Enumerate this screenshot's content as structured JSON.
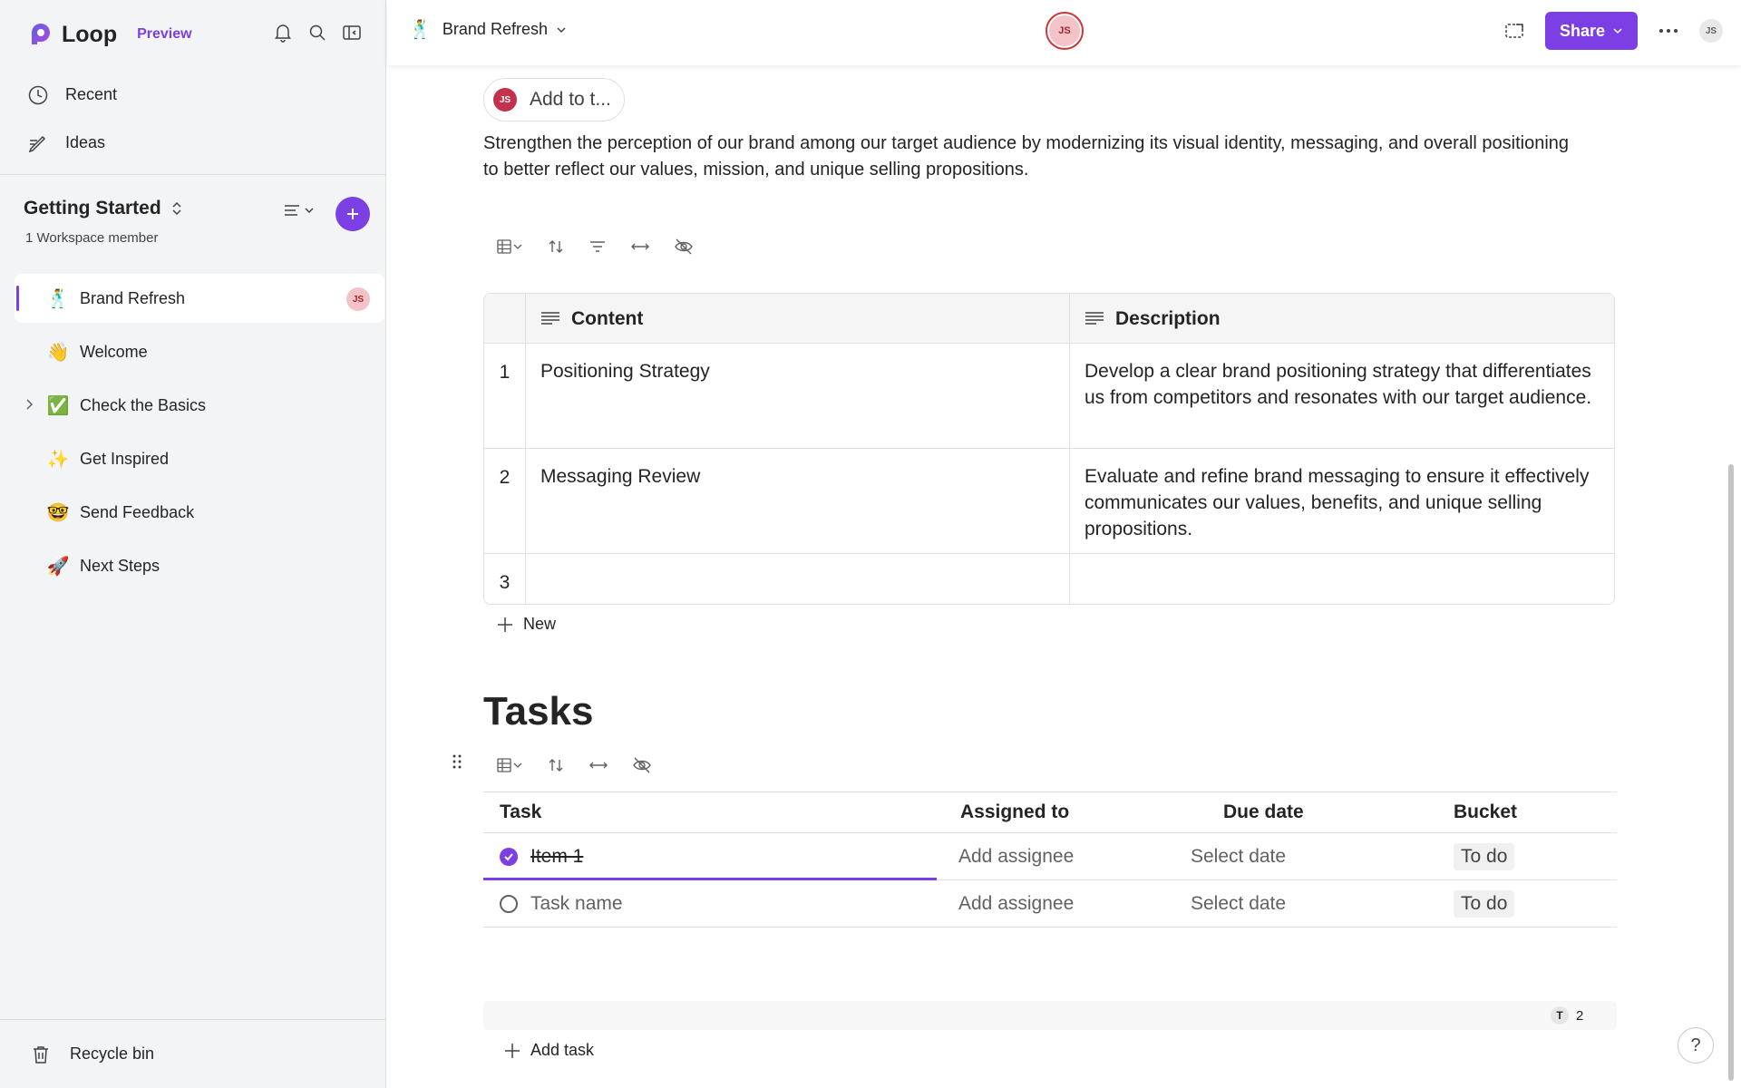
{
  "app": {
    "name": "Loop",
    "badge": "Preview"
  },
  "sidebar": {
    "nav": [
      {
        "label": "Recent",
        "icon": "clock-icon"
      },
      {
        "label": "Ideas",
        "icon": "pencil-icon"
      }
    ],
    "workspace": {
      "title": "Getting Started",
      "members": "1 Workspace member"
    },
    "pages": [
      {
        "label": "Brand Refresh",
        "emoji": "🕺",
        "active": true,
        "avatar": "JS"
      },
      {
        "label": "Welcome",
        "emoji": "👋"
      },
      {
        "label": "Check the Basics",
        "emoji": "✅",
        "expandable": true
      },
      {
        "label": "Get Inspired",
        "emoji": "✨"
      },
      {
        "label": "Send Feedback",
        "emoji": "🤓"
      },
      {
        "label": "Next Steps",
        "emoji": "🚀"
      }
    ],
    "recycle": "Recycle bin"
  },
  "header": {
    "title": "Brand Refresh",
    "emoji": "🕺",
    "presence_initials": "JS",
    "share_label": "Share",
    "user_initials": "JS"
  },
  "doc": {
    "add_to_label": "Add to t...",
    "add_to_initials": "JS",
    "intro": "Strengthen the perception of our brand among our target audience by modernizing its visual identity, messaging, and overall positioning to better reflect our values, mission, and unique selling propositions.",
    "table": {
      "headers": [
        "Content",
        "Description"
      ],
      "rows": [
        {
          "num": "1",
          "content": "Positioning Strategy",
          "desc": "Develop a clear brand positioning strategy that differentiates us from competitors and resonates with our target audience."
        },
        {
          "num": "2",
          "content": "Messaging Review",
          "desc": "Evaluate and refine brand messaging to ensure it effectively communicates our values, benefits, and unique selling propositions."
        },
        {
          "num": "3",
          "content": "",
          "desc": ""
        }
      ],
      "new_label": "New"
    },
    "tasks": {
      "heading": "Tasks",
      "headers": {
        "task": "Task",
        "assigned": "Assigned to",
        "due": "Due date",
        "bucket": "Bucket"
      },
      "rows": [
        {
          "task": "Item 1",
          "done": true,
          "assigned": "Add assignee",
          "due": "Select date",
          "bucket": "To do"
        },
        {
          "task": "Task name",
          "done": false,
          "assigned": "Add assignee",
          "due": "Select date",
          "bucket": "To do"
        }
      ],
      "summary_letter": "T",
      "summary_count": "2",
      "add_label": "Add task"
    }
  },
  "help_label": "?",
  "colors": {
    "accent": "#7b3fe4",
    "avatar_bg": "#f4c3c7",
    "avatar_fg": "#a4262c"
  }
}
